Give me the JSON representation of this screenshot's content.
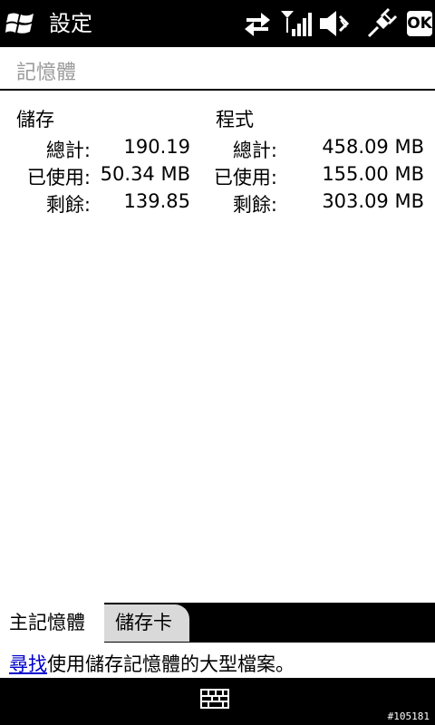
{
  "titlebar": {
    "title": "設定",
    "ok_label": "OK"
  },
  "header": {
    "title": "記憶體"
  },
  "storage": {
    "title": "儲存",
    "rows": [
      {
        "label": "總計:",
        "value": "190.19"
      },
      {
        "label": "已使用:",
        "value": "50.34 MB"
      },
      {
        "label": "剩餘:",
        "value": "139.85"
      }
    ]
  },
  "program": {
    "title": "程式",
    "rows": [
      {
        "label": "總計:",
        "value": "458.09 MB"
      },
      {
        "label": "已使用:",
        "value": "155.00 MB"
      },
      {
        "label": "剩餘:",
        "value": "303.09 MB"
      }
    ]
  },
  "tabs": [
    {
      "label": "主記憶體",
      "active": true
    },
    {
      "label": "儲存卡",
      "active": false
    }
  ],
  "footer": {
    "link": "尋找",
    "text": "使用儲存記憶體的大型檔案。"
  },
  "build_tag": "#105181"
}
